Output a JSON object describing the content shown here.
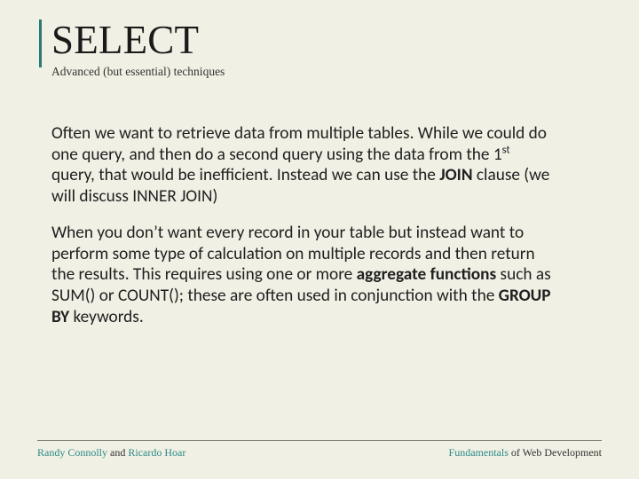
{
  "title": "SELECT",
  "subtitle": "Advanced (but essential) techniques",
  "paragraphs": {
    "p1_a": "Often we want to retrieve data from multiple tables. While we could do one query, and then do a second query using the data from the 1",
    "p1_sup": "st",
    "p1_b": " query, that would be inefficient. Instead we can use the ",
    "p1_join": "JOIN",
    "p1_c": " clause (we will discuss INNER JOIN)",
    "p2_a": "When you don’t want every record in your table but instead want to perform some type of calculation on multiple  records and then return the results. This requires using one or more ",
    "p2_agg": "aggregate functions",
    "p2_b": " such as SUM() or COUNT(); these are often used in conjunction with the ",
    "p2_group": "GROUP BY",
    "p2_c": " keywords."
  },
  "footer": {
    "left_name1": "Randy Connolly",
    "left_and": " and ",
    "left_name2": "Ricardo Hoar",
    "right_word1": "Fundamentals",
    "right_rest": " of Web Development"
  }
}
